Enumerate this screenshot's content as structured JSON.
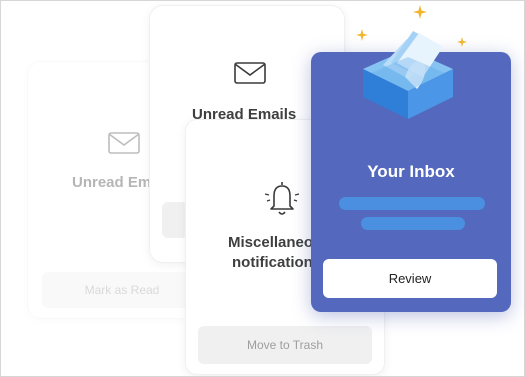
{
  "cards": {
    "back_left": {
      "title": "Unread Emails",
      "button": "Mark as Read",
      "icon": "envelope-icon"
    },
    "back_top": {
      "title": "Unread Emails",
      "icon": "envelope-icon"
    },
    "front": {
      "title_line1": "Miscellaneous",
      "title_line2": "notifications",
      "button": "Move to Trash",
      "icon": "bell-icon"
    }
  },
  "inbox": {
    "title": "Your Inbox",
    "button": "Review",
    "icon": "inbox-tray-icon",
    "bg_color": "#5468bd",
    "bar_color": "#4a8fe0"
  },
  "decorations": {
    "spark_color": "#f2b62e",
    "spark_icon": "sparkle-icon"
  }
}
